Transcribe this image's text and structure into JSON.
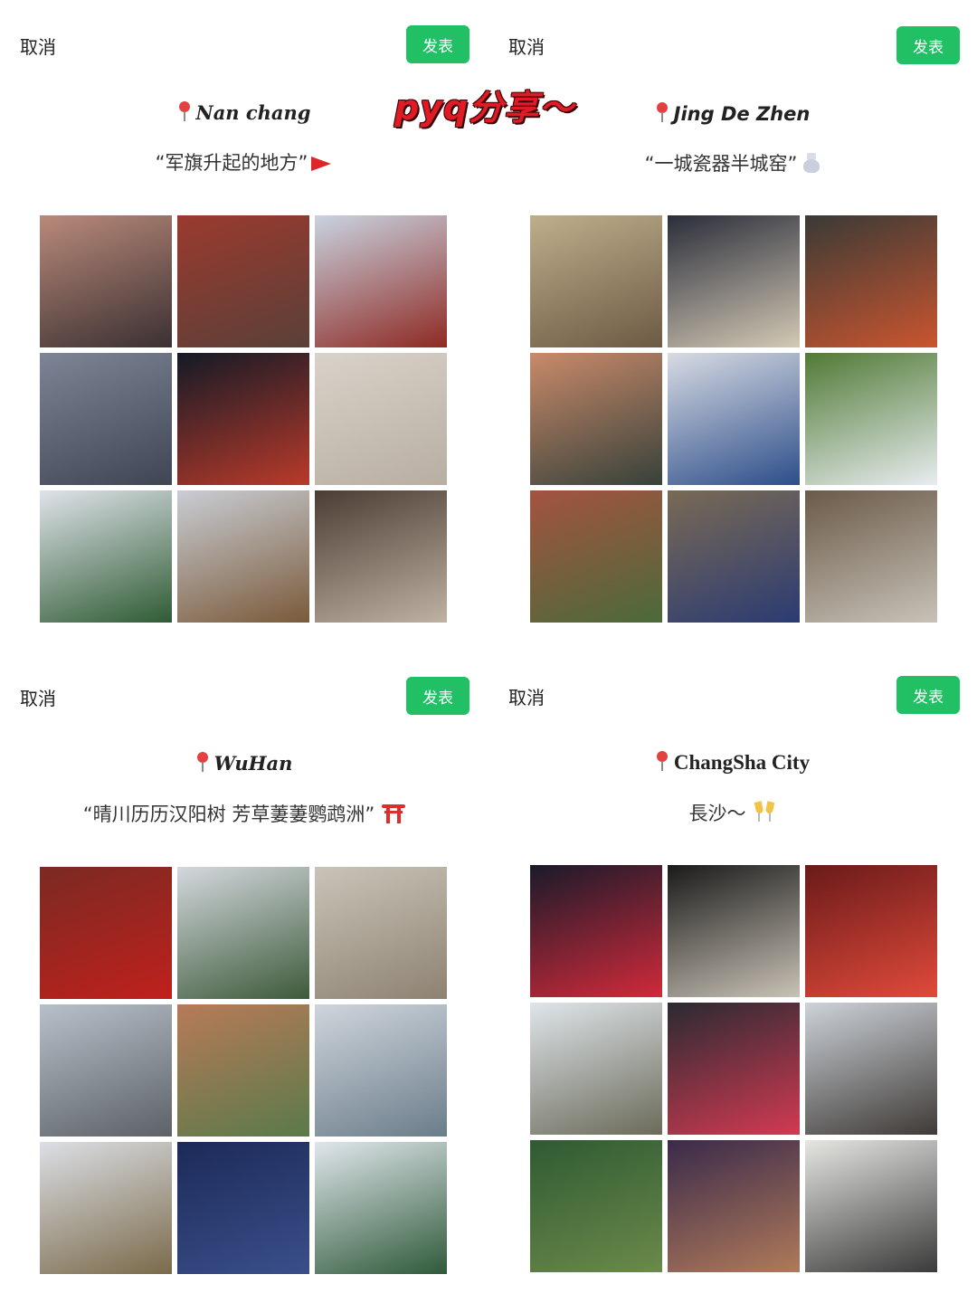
{
  "banner": "pyq分享～",
  "panels": [
    {
      "cancel": "取消",
      "post": "发表",
      "location": "Nan chang",
      "quote": "“军旗升起的地方”",
      "emoji": "flag-icon",
      "photos": [
        {
          "label": "street",
          "c1": "#b98a7a",
          "c2": "#3b3032"
        },
        {
          "label": "old-town",
          "c1": "#9b3a2e",
          "c2": "#5a4038"
        },
        {
          "label": "tengwang-pavilion",
          "c1": "#c9d3e0",
          "c2": "#8e2a24"
        },
        {
          "label": "riverside-skyline",
          "c1": "#7d8596",
          "c2": "#3f4553"
        },
        {
          "label": "pavilion-night",
          "c1": "#141a26",
          "c2": "#b93a2a"
        },
        {
          "label": "porcelain-vases",
          "c1": "#d9d2c8",
          "c2": "#b8aea2"
        },
        {
          "label": "monument",
          "c1": "#dfe3ea",
          "c2": "#2f5b34"
        },
        {
          "label": "government-hall",
          "c1": "#c9cdd4",
          "c2": "#7a5a3a"
        },
        {
          "label": "interior",
          "c1": "#4b3d33",
          "c2": "#bfb2a3"
        }
      ]
    },
    {
      "cancel": "取消",
      "post": "发表",
      "location": "Jing De Zhen",
      "quote": "“一城瓷器半城窑”",
      "emoji": "vase-icon",
      "photos": [
        {
          "label": "kiln-wall",
          "c1": "#bfae8c",
          "c2": "#6d5a44"
        },
        {
          "label": "tea-set",
          "c1": "#2a2d3a",
          "c2": "#d3c9b5"
        },
        {
          "label": "statue",
          "c1": "#3a3a36",
          "c2": "#c9552f"
        },
        {
          "label": "ceramic-flowers",
          "c1": "#c98a6a",
          "c2": "#37413a"
        },
        {
          "label": "jingdezhen-sign",
          "c1": "#d8dbe3",
          "c2": "#2d4e8a"
        },
        {
          "label": "cups-on-grass",
          "c1": "#4f7a35",
          "c2": "#e8ecef"
        },
        {
          "label": "red-building",
          "c1": "#a4533f",
          "c2": "#4b6a3a"
        },
        {
          "label": "blue-planter",
          "c1": "#7a6a55",
          "c2": "#2b3b72"
        },
        {
          "label": "arch-alley",
          "c1": "#6b5a48",
          "c2": "#c7c2b8"
        }
      ]
    },
    {
      "cancel": "取消",
      "post": "发表",
      "location": "WuHan",
      "quote": "“晴川历历汉阳树 芳草萋萋鹦鹉洲”",
      "emoji": "torii-icon",
      "photos": [
        {
          "label": "bells",
          "c1": "#7a2a22",
          "c2": "#c0201d"
        },
        {
          "label": "yellow-crane-tower",
          "c1": "#d4d8de",
          "c2": "#3d5a3a"
        },
        {
          "label": "colonial-building",
          "c1": "#c9c4b8",
          "c2": "#8e8272"
        },
        {
          "label": "traffic",
          "c1": "#b7c0c9",
          "c2": "#5d6168"
        },
        {
          "label": "old-building",
          "c1": "#b77a58",
          "c2": "#5a7a4a"
        },
        {
          "label": "bridge",
          "c1": "#cfd5dc",
          "c2": "#6b7d8a"
        },
        {
          "label": "university",
          "c1": "#dcdfe5",
          "c2": "#7a6a4a"
        },
        {
          "label": "night-river",
          "c1": "#1c2a58",
          "c2": "#3a4f8a"
        },
        {
          "label": "lake-pavilion",
          "c1": "#e0e6ec",
          "c2": "#2f5a3a"
        }
      ]
    },
    {
      "cancel": "取消",
      "post": "发表",
      "location": "ChangSha City",
      "quote": "長沙～",
      "emoji": "clinking-glasses-icon",
      "photos": [
        {
          "label": "neon-street",
          "c1": "#1a1a2a",
          "c2": "#d02a3a"
        },
        {
          "label": "ifs-mall",
          "c1": "#1a1a1a",
          "c2": "#c9c2b6"
        },
        {
          "label": "red-skyline",
          "c1": "#6a1a1a",
          "c2": "#e04a3a"
        },
        {
          "label": "mao-statue",
          "c1": "#dfe5ea",
          "c2": "#6b6b5a"
        },
        {
          "label": "changsha-sign",
          "c1": "#2a2a32",
          "c2": "#d23a52"
        },
        {
          "label": "rooftops",
          "c1": "#cdd3da",
          "c2": "#3f3a36"
        },
        {
          "label": "pavilion-forest",
          "c1": "#2f5a33",
          "c2": "#6b8a4a"
        },
        {
          "label": "alley-night",
          "c1": "#3a2a4a",
          "c2": "#b07a5a"
        },
        {
          "label": "tiled-roofs",
          "c1": "#e6e6e3",
          "c2": "#3a3a3a"
        }
      ]
    }
  ]
}
